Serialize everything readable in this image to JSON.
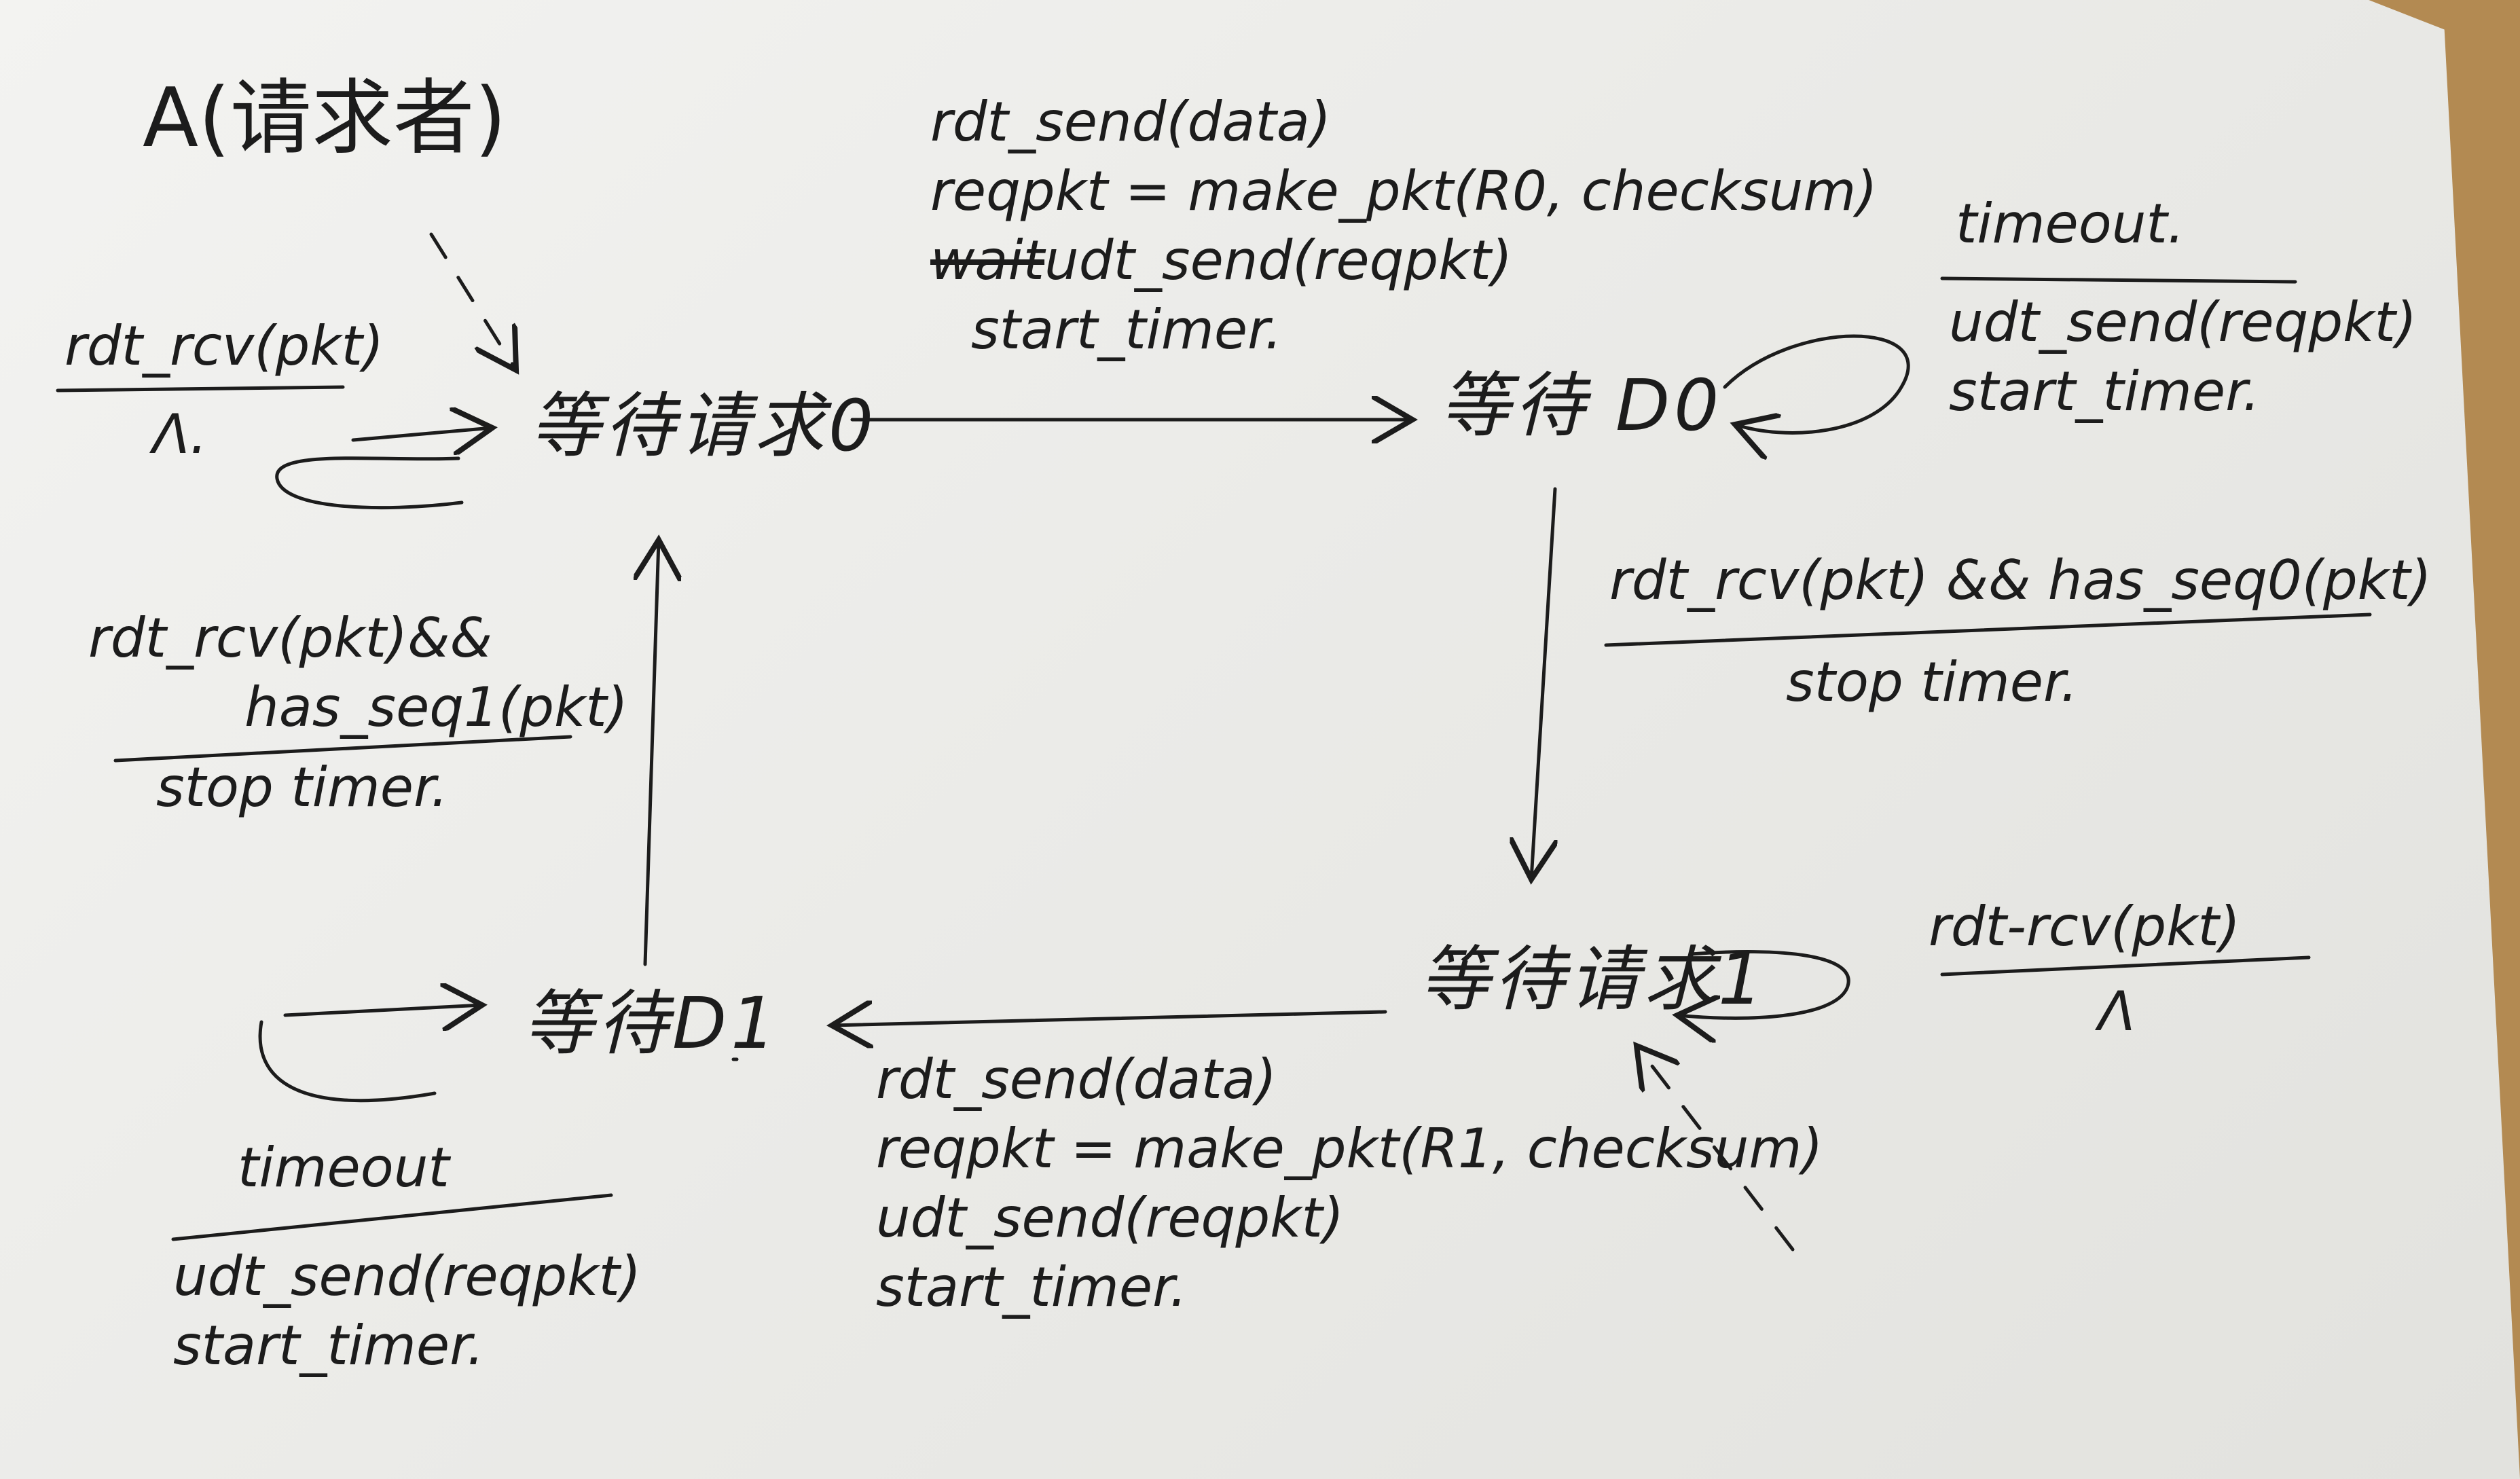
{
  "title": "A(请求者)",
  "states": {
    "wait_req0": "等待请求0",
    "wait_d0": "等待 D0",
    "wait_req1": "等待请求1",
    "wait_d1": "等待D1"
  },
  "transitions": {
    "req0_self": {
      "event": "rdt_rcv(pkt)",
      "action": "Λ."
    },
    "req0_to_d0": {
      "event": "rdt_send(data)",
      "actions": [
        "reqpkt = make_pkt(R0, checksum)",
        "wait",
        "udt_send(reqpkt)",
        "start_timer."
      ]
    },
    "d0_self": {
      "event": "timeout.",
      "actions": [
        "udt_send(reqpkt)",
        "start_timer."
      ]
    },
    "d0_to_req1": {
      "event": "rdt_rcv(pkt) && has_seq0(pkt)",
      "action": "stop timer."
    },
    "req1_self": {
      "event": "rdt-rcv(pkt)",
      "action": "Λ"
    },
    "req1_to_d1": {
      "event": "rdt_send(data)",
      "actions": [
        "reqpkt = make_pkt(R1, checksum)",
        "udt_send(reqpkt)",
        "start_timer."
      ]
    },
    "d1_self": {
      "event": "timeout",
      "actions": [
        "udt_send(reqpkt)",
        "start_timer."
      ]
    },
    "d1_to_req0": {
      "event_line1": "rdt_rcv(pkt)&&",
      "event_line2": "has_seq1(pkt)",
      "action": "stop timer."
    }
  }
}
